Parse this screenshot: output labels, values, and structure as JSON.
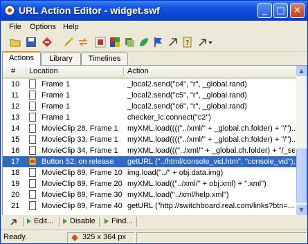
{
  "window": {
    "title": "URL Action Editor - widget.swf",
    "min_glyph": "_",
    "max_glyph": "□",
    "close_glyph": "✕"
  },
  "menu": [
    "File",
    "Options",
    "Help"
  ],
  "toolbar_icons": [
    "open-icon",
    "save-icon",
    "clear-icon",
    "wand-icon",
    "swap-icon",
    "settings-icon",
    "grid-icon",
    "layers-icon",
    "leaf-icon",
    "flag-icon",
    "cursor-icon",
    "help-icon",
    "arrow-dropdown-icon"
  ],
  "tabs": [
    "Actions",
    "Library",
    "Timelines"
  ],
  "table": {
    "headers": [
      "#",
      "Location",
      "Action"
    ],
    "rows": [
      {
        "num": "10",
        "location": "Frame 1",
        "action": "_local2.send(\"c4\", \"r\", _global.rand)",
        "icon": "frame-icon",
        "selected": false
      },
      {
        "num": "11",
        "location": "Frame 1",
        "action": "_local2.send(\"c5\", \"r\", _global.rand)",
        "icon": "frame-icon",
        "selected": false
      },
      {
        "num": "12",
        "location": "Frame 1",
        "action": "_local2.send(\"c6\", \"r\", _global.rand)",
        "icon": "frame-icon",
        "selected": false
      },
      {
        "num": "13",
        "location": "Frame 1",
        "action": "checker_lc.connect(\"c2\")",
        "icon": "frame-icon",
        "selected": false
      },
      {
        "num": "14",
        "location": "MovieClip 28, Frame 1",
        "action": "myXML.load((((\"../xml/\" + _global.ch.folder) + \"/\")...",
        "icon": "frame-icon",
        "selected": false
      },
      {
        "num": "15",
        "location": "MovieClip 33, Frame 1",
        "action": "myXML.load((((\"../xml/\" + _global.ch.folder) + \"/\")...",
        "icon": "frame-icon",
        "selected": false
      },
      {
        "num": "16",
        "location": "MovieClip 34, Frame 1",
        "action": "myXML.load(((\"../xml/\" + _global.ch.folder) + \"/_se...",
        "icon": "frame-icon",
        "selected": false
      },
      {
        "num": "17",
        "location": "Button 52, on release",
        "action": "getURL (\"../html/console_vid.htm\", \"console_vid\");",
        "icon": "button-icon",
        "selected": true
      },
      {
        "num": "18",
        "location": "MovieClip 89, Frame 10",
        "action": "img.load(\"../\" + obj.data.img)",
        "icon": "frame-icon",
        "selected": false
      },
      {
        "num": "19",
        "location": "MovieClip 89, Frame 20",
        "action": "myXML.load((\"../xml/\" + obj.xml) + \".xml\")",
        "icon": "frame-icon",
        "selected": false
      },
      {
        "num": "20",
        "location": "MovieClip 89, Frame 30",
        "action": "myXML.load(\"../xml/help.xml\")",
        "icon": "frame-icon",
        "selected": false
      },
      {
        "num": "21",
        "location": "MovieClip 89, Frame 40",
        "action": "getURL (\"http://switchboard.real.com/links?btn=...",
        "icon": "frame-icon",
        "selected": false
      }
    ]
  },
  "bottombar": {
    "edit": "Edit...",
    "disable": "Disable",
    "find": "Find..."
  },
  "status": {
    "ready": "Ready.",
    "size": "325 x 364 px"
  },
  "colors": {
    "title_gradient_top": "#3b86f7",
    "selection": "#316ac5",
    "tab_accent": "#e68b2c"
  }
}
